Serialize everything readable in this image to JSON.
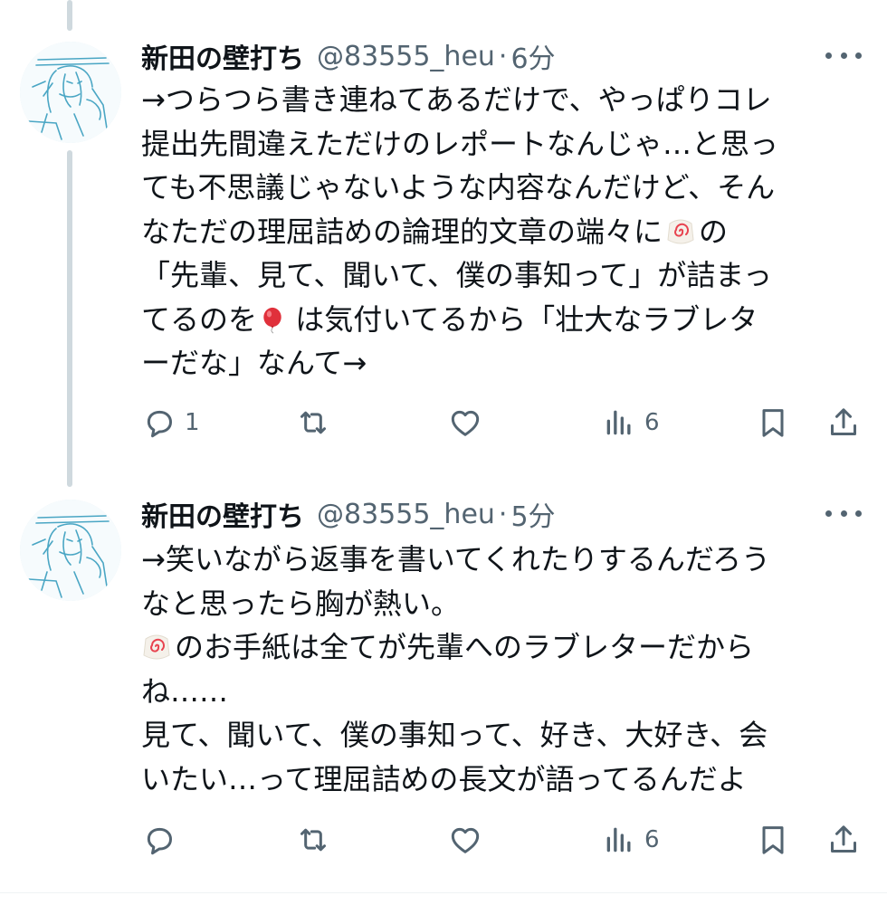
{
  "tweets": [
    {
      "display_name": "新田の壁打ち",
      "handle": "@83555_heu",
      "separator": "·",
      "time": "6分",
      "lines": [
        "→つらつら書き連ねてあるだけで、やっぱりコレ",
        "提出先間違えただけのレポートなんじゃ…と思っ",
        "ても不思議じゃないような内容なんだけど、そん",
        [
          "なただの理屈詰めの論理的文章の端々に",
          "の"
        ],
        "「先輩、見て、聞いて、僕の事知って」が詰まっ",
        [
          "てるのを",
          " は気付いてるから「壮大なラブレタ"
        ],
        "ーだな」なんて→"
      ],
      "emojis": [
        "fishcake-swirl-emoji",
        "red-balloon-emoji"
      ],
      "reply_count": "1",
      "retweet_count": "",
      "like_count": "",
      "view_count": "6"
    },
    {
      "display_name": "新田の壁打ち",
      "handle": "@83555_heu",
      "separator": "·",
      "time": "5分",
      "lines": [
        "→笑いながら返事を書いてくれたりするんだろう",
        "なと思ったら胸が熱い。",
        [
          "",
          "のお手紙は全てが先輩へのラブレターだから"
        ],
        "ね……",
        "見て、聞いて、僕の事知って、好き、大好き、会",
        "いたい…って理屈詰めの長文が語ってるんだよ"
      ],
      "emojis": [
        "fishcake-swirl-emoji"
      ],
      "reply_count": "",
      "retweet_count": "",
      "like_count": "",
      "view_count": "6"
    }
  ],
  "icons": {
    "reply": "reply-icon",
    "retweet": "retweet-icon",
    "like": "heart-icon",
    "views": "views-chart-icon",
    "bookmark": "bookmark-icon",
    "share": "share-icon",
    "more": "more-dots-icon"
  },
  "colors": {
    "text": "#0f1419",
    "secondary": "#536471",
    "thread_line": "#cfd9de",
    "avatar_sketch": "#4aa6c4"
  }
}
